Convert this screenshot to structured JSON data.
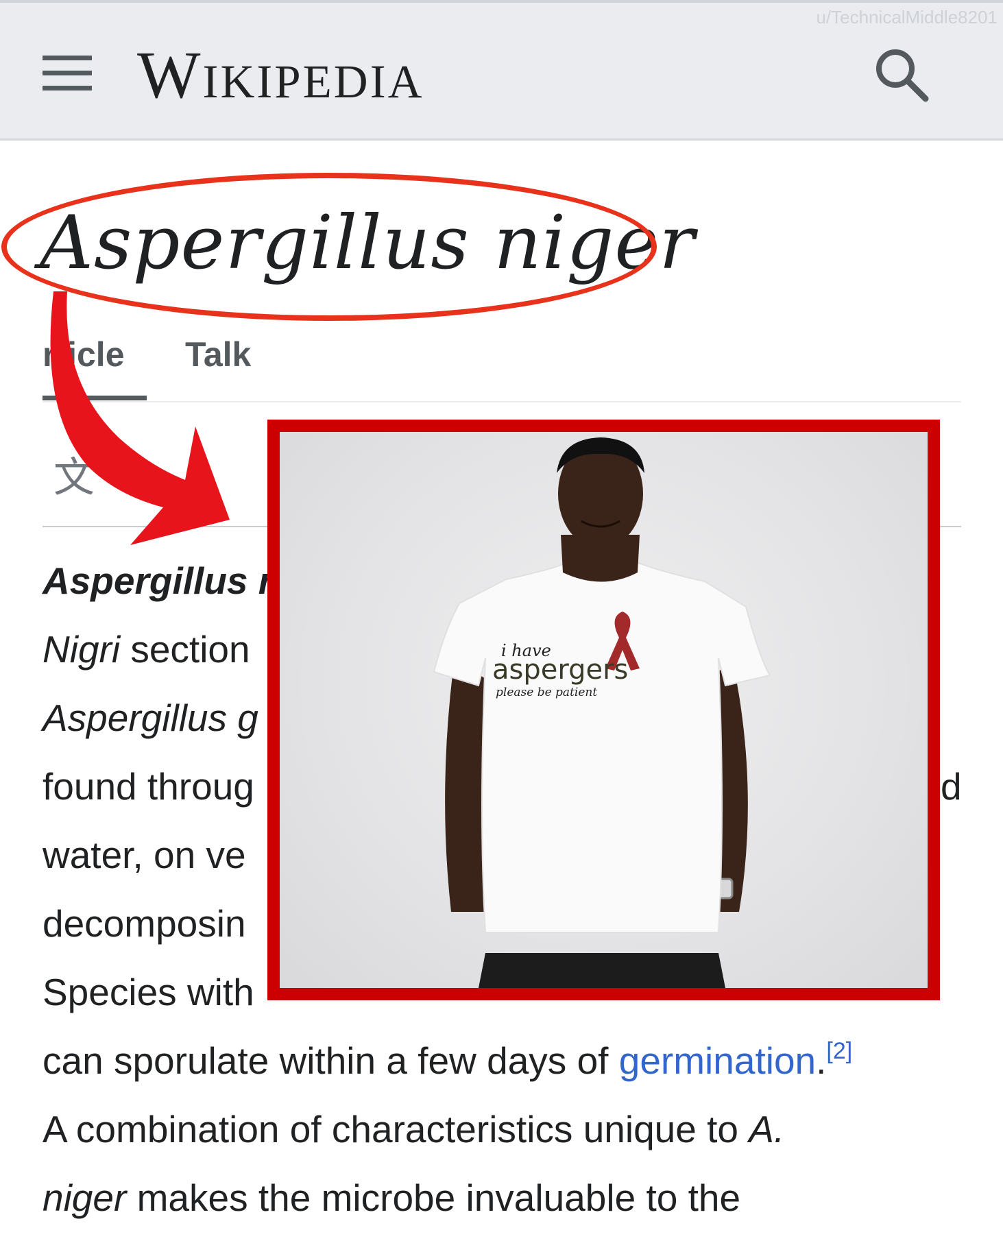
{
  "header": {
    "wordmark": "Wikipedia",
    "watermark": "u/TechnicalMiddle8201",
    "menu_icon": "hamburger-menu-icon",
    "search_icon": "search-icon"
  },
  "article": {
    "title": "Aspergillus niger",
    "tabs": [
      {
        "label": "rticle"
      },
      {
        "label": "Talk"
      }
    ],
    "language_icon": "language-icon"
  },
  "body": {
    "line1": "Aspergillus r",
    "line2a": "Nigri",
    "line2b": " section",
    "line3": "Aspergillus g",
    "line4": "found throug",
    "line4_end": "d",
    "line5": "water, on ve",
    "line6": "decomposin",
    "line7": "Species with",
    "line8a": "can sporulate within a few days of ",
    "line8_link": "germination",
    "line8_end": ".",
    "line8_ref": "[2]",
    "line9a": "A combination of characteristics unique to ",
    "line9b": "A.",
    "line10a": "niger",
    "line10b": " makes the microbe invaluable to the"
  },
  "overlay": {
    "shirt_line1": "i have",
    "shirt_line2": "aspergers",
    "shirt_line3": "please be patient"
  },
  "colors": {
    "annotation_red": "#e8321c",
    "frame_red": "#cc0000",
    "link_blue": "#3366cc"
  }
}
